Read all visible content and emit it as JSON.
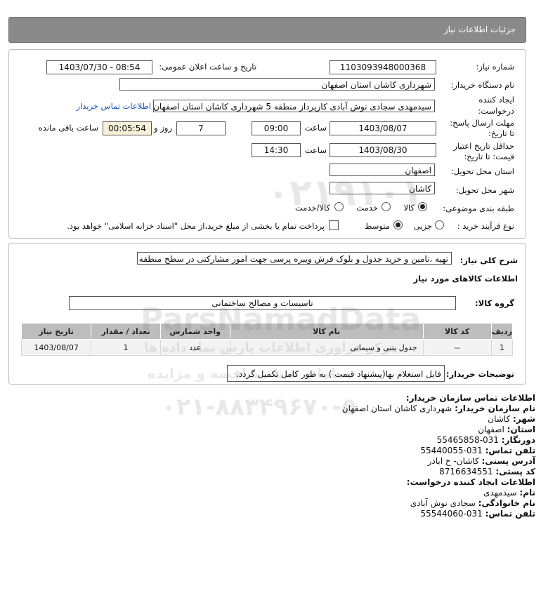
{
  "header": {
    "title": "جزئیات اطلاعات نیاز"
  },
  "form": {
    "need_number_label": "شماره نیاز:",
    "need_number": "1103093948000368",
    "announce_label": "تاریخ و ساعت اعلان عمومی:",
    "announce_value": "1403/07/30 - 08:54",
    "buyer_org_label": "نام دستگاه خریدار:",
    "buyer_org": "شهرداری کاشان استان اصفهان",
    "creator_label_1": "ایجاد کننده",
    "creator_label_2": "درخواست:",
    "creator": "سیدمهدی سجادی نوش آبادی کارپرداز منطقه 5 شهرداری کاشان استان اصفهان",
    "buyer_contact_link": "اطلاعات تماس خریدار",
    "deadline_label_1": "مهلت ارسال پاسخ:",
    "deadline_label_2": "تا تاریخ:",
    "deadline_date": "1403/08/07",
    "time_label": "ساعت",
    "deadline_time": "09:00",
    "days_value": "7",
    "days_label": "روز و",
    "remaining_time": "00:05:54",
    "remaining_label": "ساعت باقی مانده",
    "validity_label_1": "حداقل تاریخ اعتبار",
    "validity_label_2": "قیمت: تا تاریخ:",
    "validity_date": "1403/08/30",
    "validity_time": "14:30",
    "province_label": "استان محل تحویل:",
    "province": "اصفهان",
    "city_label": "شهر محل تحویل:",
    "city": "کاشان",
    "category_label": "طبقه بندی موضوعی:",
    "category_options": [
      "کالا",
      "خدمت",
      "کالا/خدمت"
    ],
    "process_label": "نوع فرآیند خرید :",
    "process_options": [
      "جزیی",
      "متوسط"
    ],
    "payment_note": "پرداخت تمام یا بخشی از مبلغ خرید،از محل \"اسناد خزانه اسلامی\" خواهد بود."
  },
  "summary": {
    "label": "شرح کلی نیاز:",
    "value": "تهیه ،تامین و خرید جدول و بلوک فرش ویبره پرسی جهت امور مشارکتی در سطح منطقه",
    "goods_info_title": "اطلاعات کالاهای مورد نیاز",
    "goods_group_label": "گروه کالا:",
    "goods_group": "تاسیسات و مصالح ساختمانی"
  },
  "table": {
    "headers": [
      "ردیف",
      "کد کالا",
      "نام کالا",
      "واحد شمارش",
      "تعداد / مقدار",
      "تاریخ نیاز"
    ],
    "rows": [
      [
        "1",
        "--",
        "جدول بتنی و سیمانی",
        "عدد",
        "1",
        "1403/08/07"
      ]
    ]
  },
  "buyer_notes": {
    "label": "توضیحات خریدار:",
    "value": "فایل استعلام بها(پیشنهاد قیمت ) به طور کامل تکمیل گردد."
  },
  "contact": {
    "title": "اطلاعات تماس سازمان خریدار:",
    "org_label": "نام سازمان خریدار:",
    "org": "شهرداری کاشان استان اصفهان",
    "city_label": "شهر:",
    "city": "کاشان",
    "province_label": "استان:",
    "province": "اصفهان",
    "fax_label": "دورنگار:",
    "fax": "031-55465858",
    "phone_label": "تلفن تماس:",
    "phone": "031-55440055",
    "address_label": "آدرس پستی:",
    "address": "کاشان- خ اباذر",
    "postal_label": "کد پستی:",
    "postal": "8716634551",
    "creator_title": "اطلاعات ایجاد کننده درخواست:",
    "first_name_label": "نام:",
    "first_name": "سیدمهدی",
    "last_name_label": "نام خانوادگی:",
    "last_name": "سجادی نوش آبادی",
    "creator_phone_label": "تلفن تماس:",
    "creator_phone": "031-55544060"
  },
  "watermark": {
    "line1": "ParsNamadData",
    "line2": "مرکز فراوری اطلاعات پارس نماد داده ها",
    "line3": "سامانه ستاد مناقصه و مزایده",
    "line4": "۰۲۱-۸۸۳۴۹۶۷۰-۵",
    "digits": "۰۲۱۹۱۰۱"
  }
}
